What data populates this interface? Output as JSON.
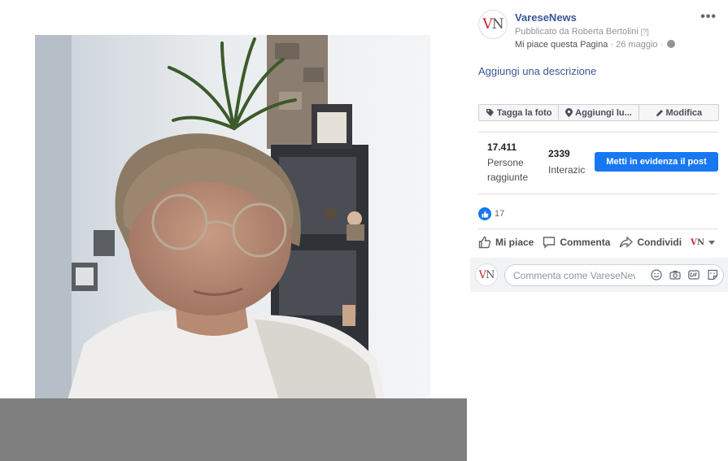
{
  "post": {
    "page_name": "VareseNews",
    "logo_text_v": "V",
    "logo_text_n": "N",
    "published_by": "Pubblicato da Roberta Bertolini",
    "published_help": "[?]",
    "like_page": "Mi piace questa Pagina",
    "separator": " · ",
    "date": "26 maggio",
    "more_label": "•••",
    "add_description": "Aggiungi una descrizione"
  },
  "toolbar": {
    "tag_photo": "Tagga la foto",
    "add_location": "Aggiungi lu...",
    "edit": "Modifica"
  },
  "insights": {
    "reach_value": "17.411",
    "reach_label_1": "Persone",
    "reach_label_2": "raggiunte",
    "interactions_value": "2339",
    "interactions_label": "Interazic",
    "boost_button": "Metti in evidenza il post"
  },
  "reactions": {
    "count": "17"
  },
  "actions": {
    "like": "Mi piace",
    "comment": "Commenta",
    "share": "Condividi"
  },
  "comment": {
    "placeholder": "Commenta come VareseNews"
  },
  "colors": {
    "link": "#385898",
    "accent": "#1877f2",
    "brand_red": "#c0262d"
  }
}
